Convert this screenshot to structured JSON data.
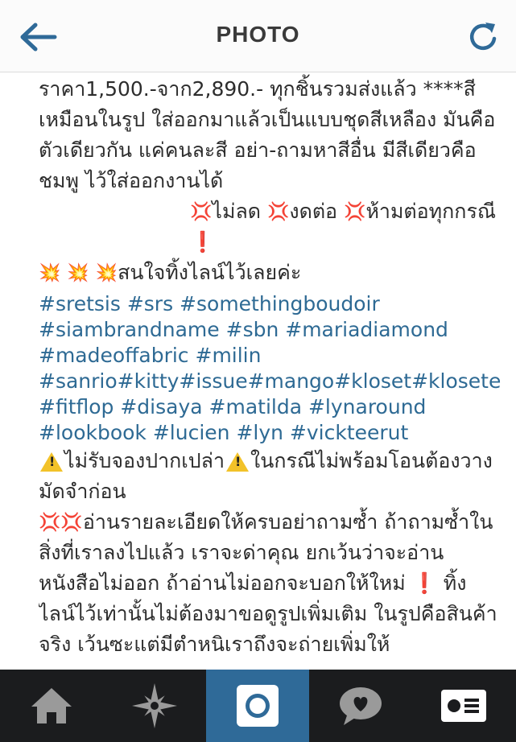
{
  "header": {
    "title": "PHOTO",
    "back_icon": "arrow-left-icon",
    "refresh_icon": "refresh-icon",
    "accent_color": "#2f6a98"
  },
  "caption": {
    "intro": "ราคา1,500.-จาก2,890.- ทุกชิ้นรวมส่งแล้ว ****สีเหมือนในรูป ใส่ออกมาแล้วเป็นแบบชุดสีเหลือง มันคือตัวเดียวกัน แค่คนละสี อย่า-ถามหาสีอื่น มีสีเดียวคือชมพู ไว้ใส่ออกงานได้",
    "rule_1": "ไม่ลด",
    "rule_2": "งดต่อ",
    "rule_3": "ห้ามต่อทุกกรณี",
    "contact": "สนใจทิ้งไลน์ไว้เลยค่ะ",
    "hashtags": "#sretsis #srs #somethingboudoir #siambrandname #sbn #mariadiamond #madeoffabric #milin #sanrio#kitty#issue#mango#kloset#klosetetcetera#mng#hahahathehappygirls #fitflop #disaya #matilda #lynaround #lookbook #lucien #lyn #vickteerut",
    "no_reserve": "ไม่รับจองปากเปล่า",
    "deposit": "ในกรณีไม่พร้อมโอนต้องวางมัดจำก่อน",
    "warning_text": "อ่านรายละเอียดให้ครบอย่าถามซ้ำ ถ้าถามซ้ำในสิ่งที่เราลงไปแล้ว เราจะด่าคุณ ยกเว้นว่าจะอ่านหนังสือไม่ออก ถ้าอ่านไม่ออกจะบอกให้ใหม่",
    "line_text": "ทิ้งไลน์ไว้เท่านั้นไม่ต้องมาขอดูรูปเพิ่มเติม ในรูปคือสินค้าจริง เว้นซะแต่มีตำหนิเราถึงจะถ่ายเพิ่มให้"
  },
  "tabbar": {
    "items": [
      {
        "icon": "home-icon"
      },
      {
        "icon": "explore-icon"
      },
      {
        "icon": "camera-icon",
        "active": true
      },
      {
        "icon": "activity-icon"
      },
      {
        "icon": "profile-icon"
      }
    ]
  }
}
